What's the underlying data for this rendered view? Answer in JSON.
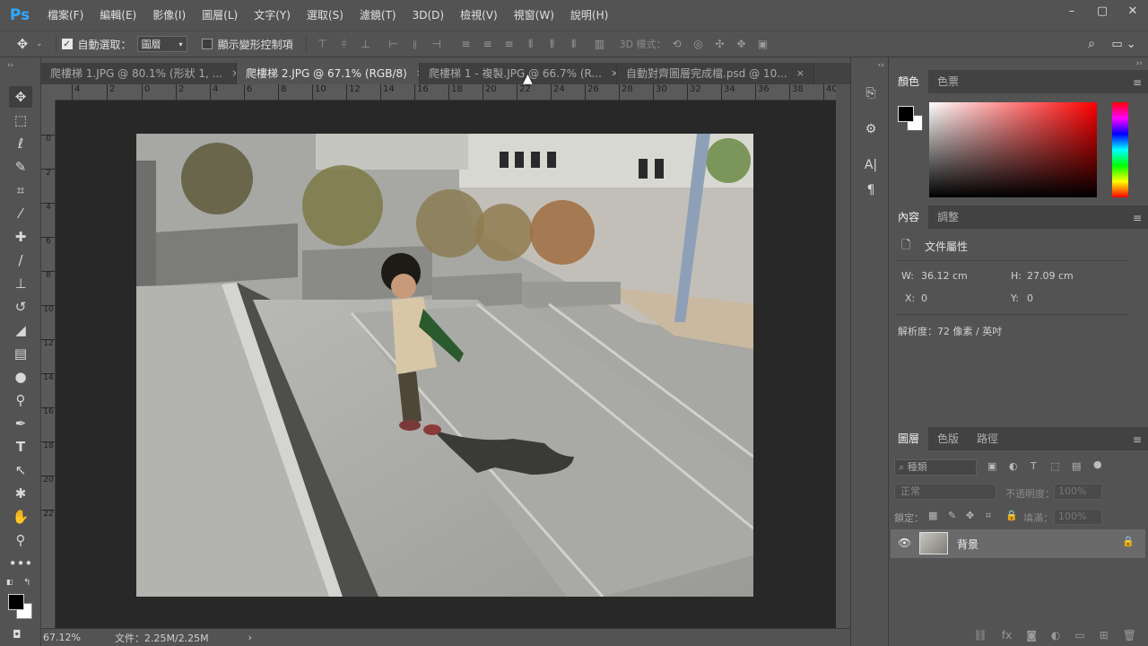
{
  "app": {
    "logo": "Ps"
  },
  "menu": [
    "檔案(F)",
    "編輯(E)",
    "影像(I)",
    "圖層(L)",
    "文字(Y)",
    "選取(S)",
    "濾鏡(T)",
    "3D(D)",
    "檢視(V)",
    "視窗(W)",
    "說明(H)"
  ],
  "window_controls": {
    "minimize": "–",
    "restore": "▢",
    "close": "✕"
  },
  "options": {
    "auto_select_label": "自動選取：",
    "auto_select_value": "圖層",
    "show_transform_label": "顯示變形控制項",
    "mode_3d_label": "3D 模式："
  },
  "doc_tabs": [
    {
      "label": "爬樓梯 1.JPG @ 80.1% (形狀 1, ...",
      "close": "×"
    },
    {
      "label": "爬樓梯 2.JPG @ 67.1% (RGB/8)",
      "close": "×"
    },
    {
      "label": "爬樓梯 1 - 複製.JPG @ 66.7% (R...",
      "close": "×"
    },
    {
      "label": "自動對齊圖層完成檔.psd @ 10...",
      "close": "×"
    }
  ],
  "ruler_h": [
    "4",
    "2",
    "0",
    "2",
    "4",
    "6",
    "8",
    "10",
    "12",
    "14",
    "16",
    "18",
    "20",
    "22",
    "24",
    "26",
    "28",
    "30",
    "32",
    "34",
    "36",
    "38",
    "40"
  ],
  "ruler_v": [
    "0",
    "2",
    "4",
    "6",
    "8",
    "10",
    "12",
    "14",
    "16",
    "18",
    "20",
    "22"
  ],
  "status": {
    "zoom": "67.12%",
    "doc": "文件：2.25M/2.25M",
    "arrow": "›"
  },
  "color_panel": {
    "tabs": [
      "顏色",
      "色票"
    ],
    "foreground": "#000000",
    "background": "#ffffff",
    "hue": "#ff0000"
  },
  "properties_panel": {
    "tabs": [
      "內容",
      "調整"
    ],
    "title": "文件屬性",
    "w_label": "W:",
    "w_value": "36.12 cm",
    "h_label": "H:",
    "h_value": "27.09 cm",
    "x_label": "X:",
    "x_value": "0",
    "y_label": "Y:",
    "y_value": "0",
    "resolution": "解析度：72 像素 / 英吋"
  },
  "layers_panel": {
    "tabs": [
      "圖層",
      "色版",
      "路徑"
    ],
    "filter": "種類",
    "blend": "正常",
    "opacity_label": "不透明度：",
    "opacity": "100%",
    "lock_label": "鎖定：",
    "fill_label": "填滿：",
    "fill": "100%",
    "layers": [
      {
        "name": "背景",
        "visible": true,
        "locked": true
      }
    ]
  }
}
